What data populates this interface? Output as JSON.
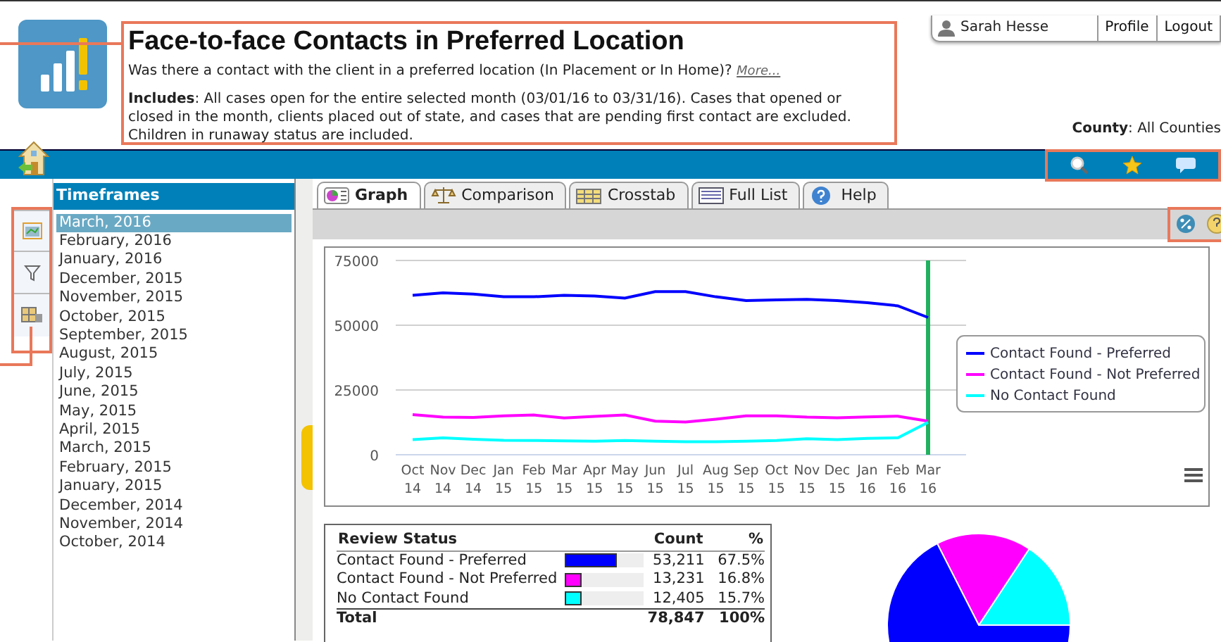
{
  "header": {
    "title": "Face-to-face Contacts in Preferred Location",
    "question": "Was there a contact with the client in a preferred location (In Placement or In Home)?",
    "more_link": "More...",
    "includes": "**Includes**:  All cases open for the entire selected month (03/01/16 to 03/31/16). Cases that opened or closed in the month, clients placed out of state, and cases that are pending first contact are excluded. Children in runaway status are included."
  },
  "user": {
    "name": "Sarah Hesse",
    "links": [
      "Profile",
      "Logout"
    ]
  },
  "county": "**County**: All Counties",
  "timeframes": {
    "title": "Timeframes",
    "items": [
      {
        "label": "March, 2016",
        "selected": true
      },
      {
        "label": "February, 2016",
        "selected": false
      },
      {
        "label": "January, 2016",
        "selected": false
      },
      {
        "label": "December, 2015",
        "selected": false
      },
      {
        "label": "November, 2015",
        "selected": false
      },
      {
        "label": "October, 2015",
        "selected": false
      },
      {
        "label": "September, 2015",
        "selected": false
      },
      {
        "label": "August, 2015",
        "selected": false
      },
      {
        "label": "July, 2015",
        "selected": false
      },
      {
        "label": "June, 2015",
        "selected": false
      },
      {
        "label": "May, 2015",
        "selected": false
      },
      {
        "label": "April, 2015",
        "selected": false
      },
      {
        "label": "March, 2015",
        "selected": false
      },
      {
        "label": "February, 2015",
        "selected": false
      },
      {
        "label": "January, 2015",
        "selected": false
      },
      {
        "label": "December, 2014",
        "selected": false
      },
      {
        "label": "November, 2014",
        "selected": false
      },
      {
        "label": "October, 2014",
        "selected": false
      }
    ]
  },
  "tabs": [
    {
      "label": "Graph",
      "kind": "graph",
      "selected": true
    },
    {
      "label": "Comparison",
      "kind": "comparison",
      "selected": false
    },
    {
      "label": "Crosstab",
      "kind": "crosstab",
      "selected": false
    },
    {
      "label": "Full List",
      "kind": "list",
      "selected": false
    },
    {
      "label": "Help",
      "kind": "help",
      "selected": false
    }
  ],
  "trend_chart": {
    "chart_data": {
      "type": "line",
      "categories": [
        "Oct 14",
        "Nov 14",
        "Dec 14",
        "Jan 15",
        "Feb 15",
        "Mar 15",
        "Apr 15",
        "May 15",
        "Jun 15",
        "Jul 15",
        "Aug 15",
        "Sep 15",
        "Oct 15",
        "Nov 15",
        "Dec 15",
        "Jan 16",
        "Feb 16",
        "Mar 16"
      ],
      "ylim": [
        0,
        75000
      ],
      "yticks": [
        0,
        25000,
        50000,
        75000
      ],
      "series": [
        {
          "name": "Contact Found - Preferred",
          "color": "#0000ff",
          "values": [
            61500,
            62500,
            62000,
            61000,
            61000,
            61500,
            61300,
            60500,
            63000,
            63000,
            61000,
            59500,
            59800,
            60000,
            59500,
            58700,
            57500,
            53000
          ]
        },
        {
          "name": "Contact Found - Not Preferred",
          "color": "#ff00ff",
          "values": [
            15500,
            14500,
            14400,
            15000,
            15300,
            14200,
            14800,
            15300,
            13000,
            12600,
            13700,
            15000,
            15000,
            14500,
            14300,
            14600,
            14900,
            13000
          ]
        },
        {
          "name": "No Contact Found",
          "color": "#00ffff",
          "values": [
            5800,
            6500,
            6000,
            5600,
            5500,
            5400,
            5200,
            5500,
            5200,
            5000,
            5000,
            5200,
            5500,
            6200,
            5800,
            6300,
            6500,
            12500
          ]
        }
      ],
      "legend": true,
      "ref_lines": [
        {
          "axis": "x",
          "value": "Mar 16",
          "color": "#22b060"
        }
      ]
    }
  },
  "summary": {
    "columns": [
      "Review Status",
      "Count",
      "%"
    ],
    "rows": [
      {
        "label": "Contact Found - Preferred",
        "color": "#0000ff",
        "level": 0.675,
        "count": "53,211",
        "percent": "67.5%"
      },
      {
        "label": "Contact Found - Not Preferred",
        "color": "#ff00ff",
        "level": 0.168,
        "count": "13,231",
        "percent": "16.8%"
      },
      {
        "label": "No Contact Found",
        "color": "#00ffff",
        "level": 0.157,
        "count": "12,405",
        "percent": "15.7%"
      }
    ],
    "total": {
      "label": "Total",
      "count": "78,847",
      "percent": "100%"
    }
  },
  "pie_chart": {
    "chart_data": {
      "type": "pie",
      "values": [
        67.5,
        16.8,
        15.7
      ]
    }
  }
}
